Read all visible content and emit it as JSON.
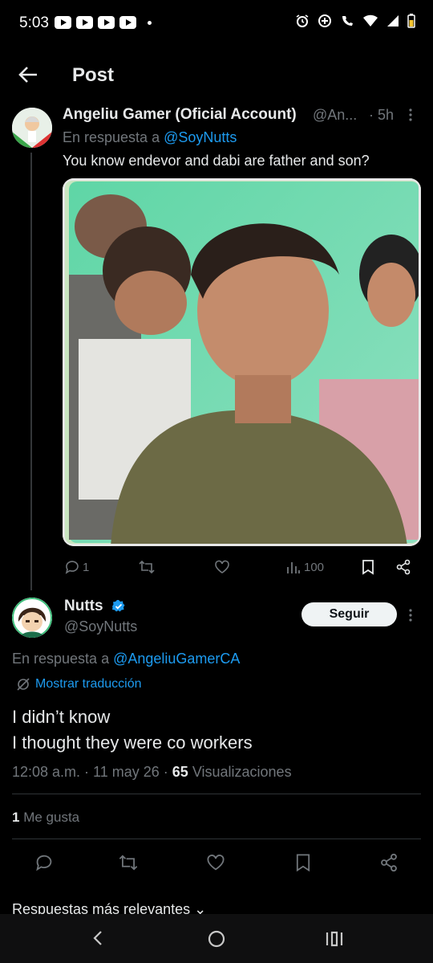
{
  "status_bar": {
    "time": "5:03"
  },
  "header": {
    "title": "Post"
  },
  "original_post": {
    "display_name": "Angeliu Gamer (Oficial Account)",
    "handle": "@An...",
    "time_ago": "· 5h",
    "reply_prefix": "En respuesta a",
    "reply_to": "@SoyNutts",
    "text": "You know endevor and dabi are father and son?",
    "replies": "1",
    "views": "100"
  },
  "main_post": {
    "display_name": "Nutts",
    "handle": "@SoyNutts",
    "follow_label": "Seguir",
    "reply_prefix": "En respuesta a",
    "reply_to": "@AngeliuGamerCA",
    "translate_label": "Mostrar traducción",
    "text_line1": "I didn’t know",
    "text_line2": "I thought they were co workers",
    "time": "12:08 a.m. · 11 may 26 ·",
    "views_count": "65",
    "views_label": "Visualizaciones",
    "likes_count": "1",
    "likes_label": "Me gusta"
  },
  "replies_section": {
    "sort_label": "Respuestas más relevantes"
  },
  "colors": {
    "accent": "#1d9bf0",
    "background": "#000000",
    "text": "#e7e9ea",
    "muted": "#71767b"
  }
}
